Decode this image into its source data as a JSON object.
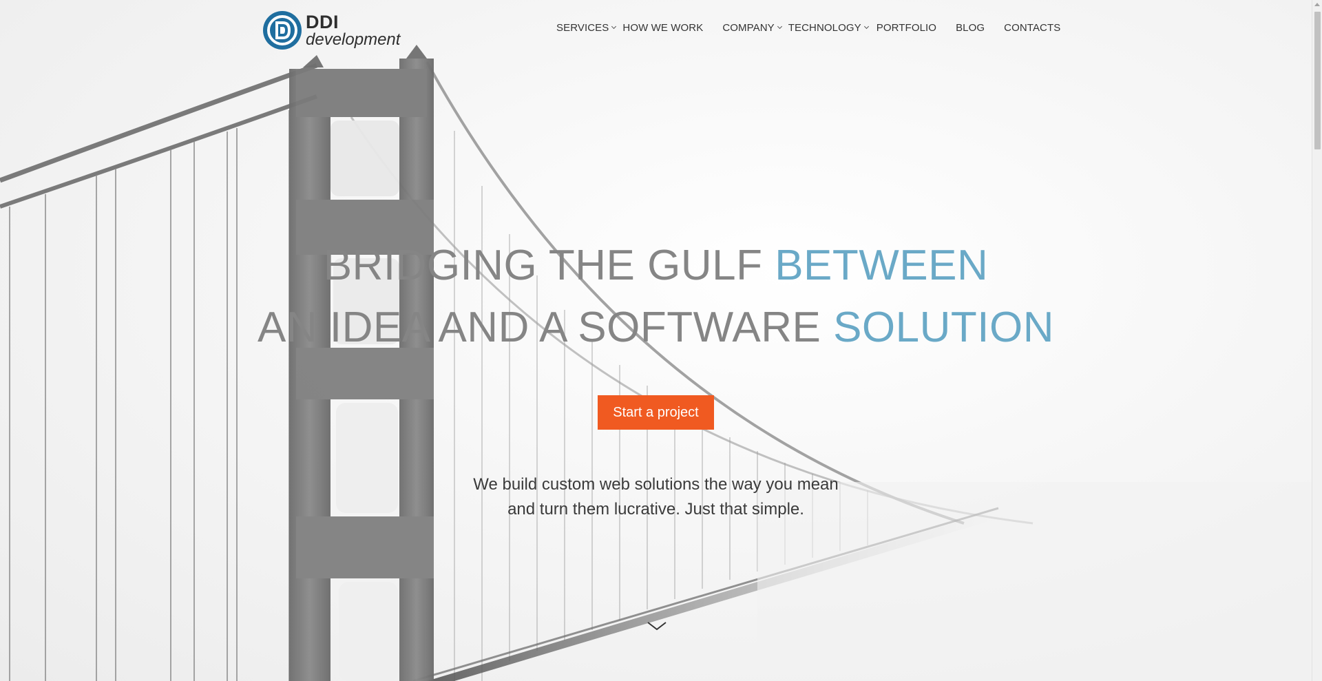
{
  "header": {
    "logo": {
      "line1": "DDI",
      "line2": "development",
      "brand_color": "#1f6e9f"
    },
    "nav": [
      {
        "label": "SERVICES",
        "has_dropdown": true
      },
      {
        "label": "HOW WE WORK",
        "has_dropdown": false
      },
      {
        "label": "COMPANY",
        "has_dropdown": true
      },
      {
        "label": "TECHNOLOGY",
        "has_dropdown": true
      },
      {
        "label": "PORTFOLIO",
        "has_dropdown": false
      },
      {
        "label": "BLOG",
        "has_dropdown": false
      },
      {
        "label": "CONTACTS",
        "has_dropdown": false
      }
    ]
  },
  "hero": {
    "headline_line1": {
      "plain": "BRIDGING THE GULF ",
      "accent": "BETWEEN"
    },
    "headline_line2": {
      "plain": "AN IDEA AND A SOFTWARE ",
      "accent": "SOLUTION"
    },
    "cta_label": "Start a project",
    "tagline_line1": "We build custom web solutions the way you mean",
    "tagline_line2": "and turn them lucrative. Just that simple.",
    "scroll_icon": "chevron-down-icon"
  },
  "colors": {
    "accent": "#6aa9c7",
    "headline_gray": "#858585",
    "cta": "#f05a21",
    "text": "#333333"
  }
}
